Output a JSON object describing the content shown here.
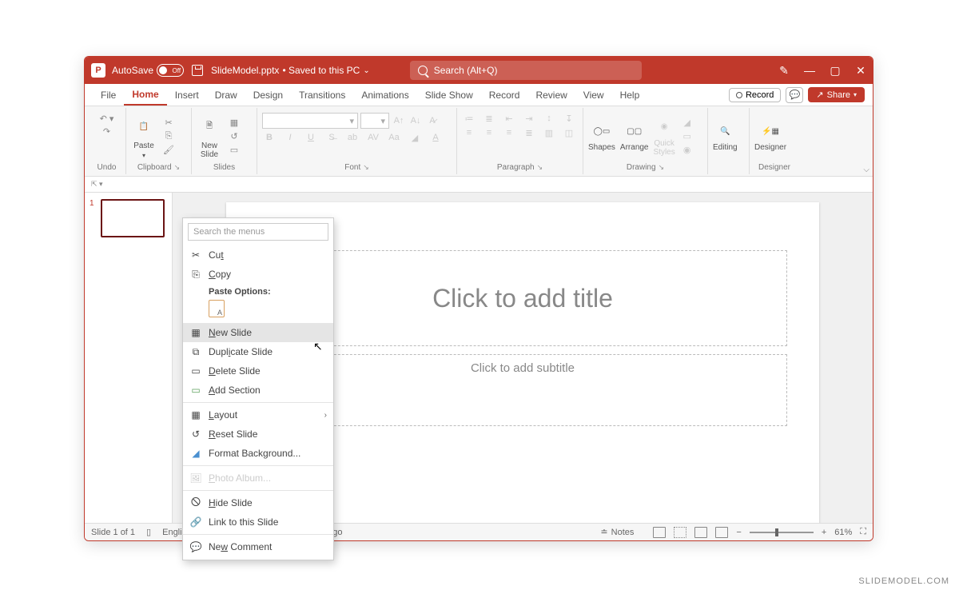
{
  "title_bar": {
    "autosave_label": "AutoSave",
    "autosave_state": "Off",
    "filename": "SlideModel.pptx",
    "saved_status": "• Saved to this PC",
    "search_placeholder": "Search (Alt+Q)"
  },
  "tabs": {
    "items": [
      "File",
      "Home",
      "Insert",
      "Draw",
      "Design",
      "Transitions",
      "Animations",
      "Slide Show",
      "Record",
      "Review",
      "View",
      "Help"
    ],
    "active_index": 1,
    "record_btn": "Record",
    "share_btn": "Share"
  },
  "ribbon": {
    "undo_label": "Undo",
    "clipboard_label": "Clipboard",
    "paste_label": "Paste",
    "slides_label": "Slides",
    "new_slide_label": "New\nSlide",
    "font_label": "Font",
    "paragraph_label": "Paragraph",
    "drawing_label": "Drawing",
    "shapes_label": "Shapes",
    "arrange_label": "Arrange",
    "quick_styles_label": "Quick\nStyles",
    "editing_label": "Editing",
    "designer_label": "Designer",
    "designer_btn": "Designer"
  },
  "slide_panel": {
    "current_number": "1"
  },
  "canvas": {
    "title_placeholder": "Click to add title",
    "subtitle_placeholder": "Click to add subtitle"
  },
  "context_menu": {
    "search_placeholder": "Search the menus",
    "cut": "Cut",
    "copy": "Copy",
    "paste_options_header": "Paste Options:",
    "new_slide": "New Slide",
    "duplicate_slide": "Duplicate Slide",
    "delete_slide": "Delete Slide",
    "add_section": "Add Section",
    "layout": "Layout",
    "reset_slide": "Reset Slide",
    "format_background": "Format Background...",
    "photo_album": "Photo Album...",
    "hide_slide": "Hide Slide",
    "link_to_slide": "Link to this Slide",
    "new_comment": "New Comment"
  },
  "status_bar": {
    "slide_count": "Slide 1 of 1",
    "language": "Englis",
    "accessibility_trunc": "o go",
    "notes": "Notes",
    "zoom": "61%"
  },
  "watermark": "SLIDEMODEL.COM"
}
